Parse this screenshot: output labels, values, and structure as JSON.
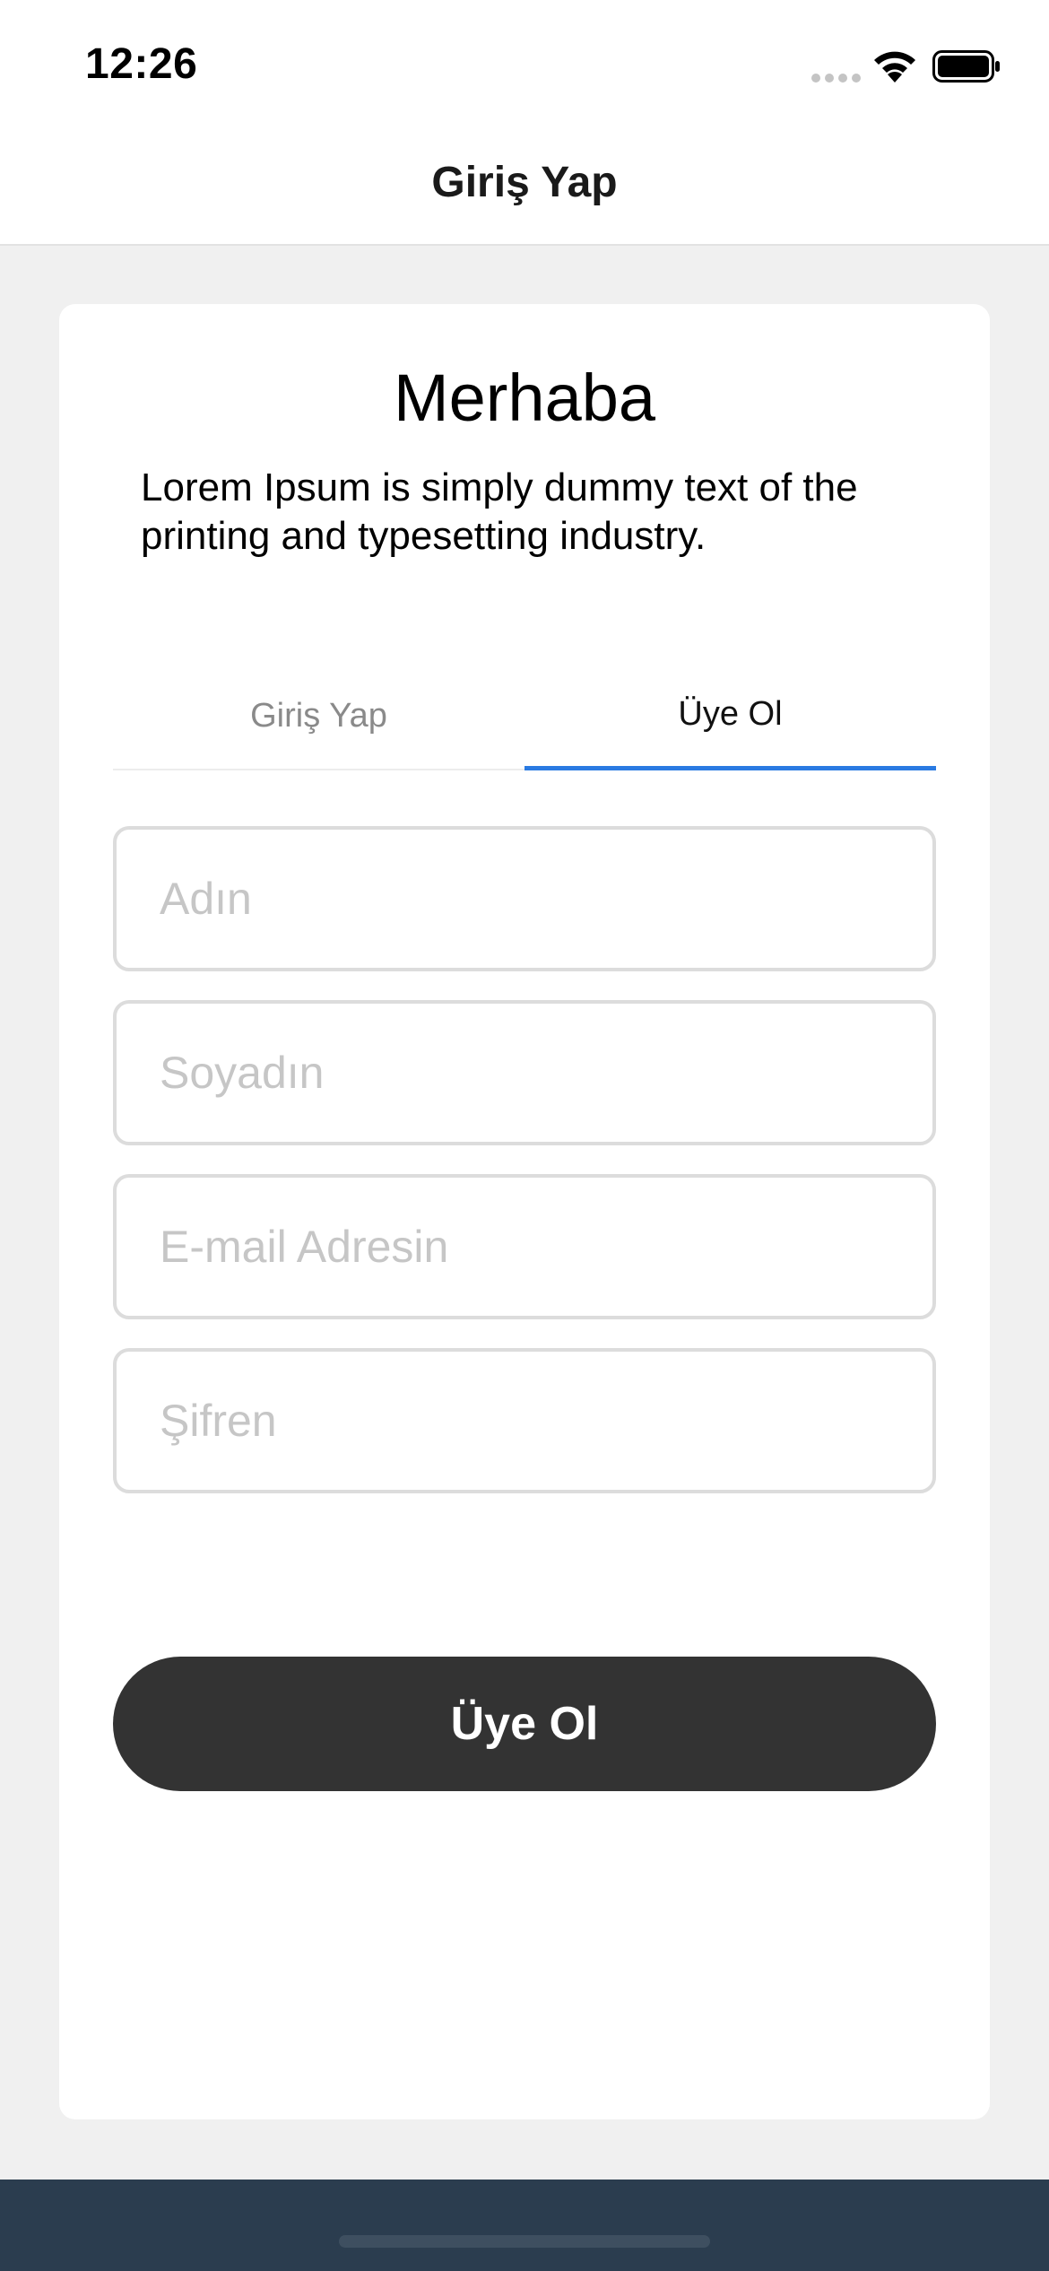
{
  "status_bar": {
    "time": "12:26",
    "icons": [
      "cellular-signal-icon",
      "wifi-icon",
      "battery-icon"
    ]
  },
  "nav": {
    "title": "Giriş Yap"
  },
  "card": {
    "greeting": "Merhaba",
    "intro": "Lorem Ipsum is simply dummy text of the printing and typesetting industry."
  },
  "tabs": [
    {
      "label": "Giriş Yap",
      "active": false
    },
    {
      "label": "Üye Ol",
      "active": true
    }
  ],
  "form": {
    "fields": [
      {
        "placeholder": "Adın",
        "value": ""
      },
      {
        "placeholder": "Soyadın",
        "value": ""
      },
      {
        "placeholder": "E-mail Adresin",
        "value": ""
      },
      {
        "placeholder": "Şifren",
        "value": ""
      }
    ],
    "submit_label": "Üye Ol"
  },
  "colors": {
    "accent": "#2a7ae2",
    "button": "#333333",
    "bottom_bar": "#2b3d4f",
    "background": "#f0f0f0"
  }
}
